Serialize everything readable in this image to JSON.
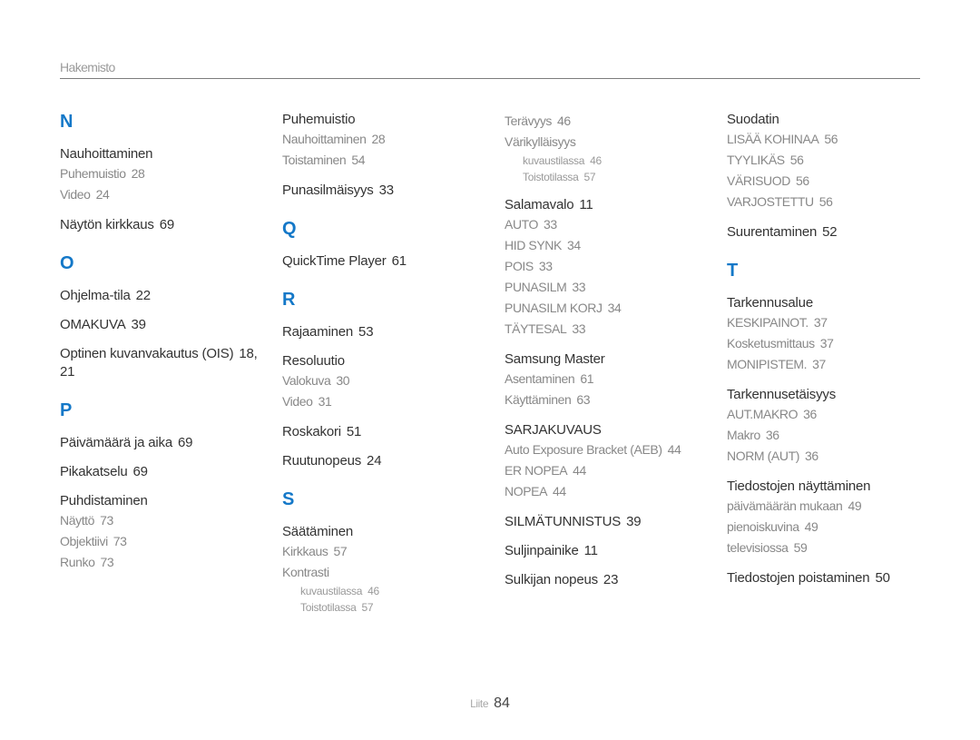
{
  "header": {
    "title": "Hakemisto"
  },
  "footer": {
    "label": "Liite",
    "page": "84"
  },
  "columns": [
    {
      "blocks": [
        {
          "letter": "N"
        },
        {
          "term": "Nauhoittaminen",
          "page": "",
          "subs": [
            {
              "term": "Puhemuistio",
              "page": "28"
            },
            {
              "term": "Video",
              "page": "24"
            }
          ]
        },
        {
          "term": "Näytön kirkkaus",
          "page": "69"
        },
        {
          "letter": "O"
        },
        {
          "term": "Ohjelma-tila",
          "page": "22"
        },
        {
          "term": "OMAKUVA",
          "page": "39"
        },
        {
          "term": "Optinen kuvanvakautus (OIS)",
          "page": "18, 21"
        },
        {
          "letter": "P"
        },
        {
          "term": "Päivämäärä ja aika",
          "page": "69"
        },
        {
          "term": "Pikakatselu",
          "page": "69"
        },
        {
          "term": "Puhdistaminen",
          "page": "",
          "subs": [
            {
              "term": "Näyttö",
              "page": "73"
            },
            {
              "term": "Objektiivi",
              "page": "73"
            },
            {
              "term": "Runko",
              "page": "73"
            }
          ]
        }
      ]
    },
    {
      "blocks": [
        {
          "term": "Puhemuistio",
          "page": "",
          "subs": [
            {
              "term": "Nauhoittaminen",
              "page": "28"
            },
            {
              "term": "Toistaminen",
              "page": "54"
            }
          ]
        },
        {
          "term": "Punasilmäisyys",
          "page": "33"
        },
        {
          "letter": "Q"
        },
        {
          "term": "QuickTime Player",
          "page": "61"
        },
        {
          "letter": "R"
        },
        {
          "term": "Rajaaminen",
          "page": "53"
        },
        {
          "term": "Resoluutio",
          "page": "",
          "subs": [
            {
              "term": "Valokuva",
              "page": "30"
            },
            {
              "term": "Video",
              "page": "31"
            }
          ]
        },
        {
          "term": "Roskakori",
          "page": "51"
        },
        {
          "term": "Ruutunopeus",
          "page": "24"
        },
        {
          "letter": "S"
        },
        {
          "term": "Säätäminen",
          "page": "",
          "subs": [
            {
              "term": "Kirkkaus",
              "page": "57"
            },
            {
              "term": "Kontrasti",
              "page": "",
              "subsubs": [
                {
                  "term": "kuvaustilassa",
                  "page": "46"
                },
                {
                  "term": "Toistotilassa",
                  "page": "57"
                }
              ]
            }
          ]
        }
      ]
    },
    {
      "blocks": [
        {
          "continuation": true,
          "subs": [
            {
              "term": "Terävyys",
              "page": "46"
            },
            {
              "term": "Värikylläisyys",
              "page": "",
              "subsubs": [
                {
                  "term": "kuvaustilassa",
                  "page": "46"
                },
                {
                  "term": "Toistotilassa",
                  "page": "57"
                }
              ]
            }
          ]
        },
        {
          "term": "Salamavalo",
          "page": "11",
          "subs": [
            {
              "term": "AUTO",
              "page": "33"
            },
            {
              "term": "HID SYNK",
              "page": "34"
            },
            {
              "term": "POIS",
              "page": "33"
            },
            {
              "term": "PUNASILM",
              "page": "33"
            },
            {
              "term": "PUNASILM KORJ",
              "page": "34"
            },
            {
              "term": "TÄYTESAL",
              "page": "33"
            }
          ]
        },
        {
          "term": "Samsung Master",
          "page": "",
          "subs": [
            {
              "term": "Asentaminen",
              "page": "61"
            },
            {
              "term": "Käyttäminen",
              "page": "63"
            }
          ]
        },
        {
          "term": "SARJAKUVAUS",
          "page": "",
          "subs": [
            {
              "term": "Auto Exposure Bracket (AEB)",
              "page": "44"
            },
            {
              "term": "ER NOPEA",
              "page": "44"
            },
            {
              "term": "NOPEA",
              "page": "44"
            }
          ]
        },
        {
          "term": "SILMÄTUNNISTUS",
          "page": "39"
        },
        {
          "term": "Suljinpainike",
          "page": "11"
        },
        {
          "term": "Sulkijan nopeus",
          "page": "23"
        }
      ]
    },
    {
      "blocks": [
        {
          "term": "Suodatin",
          "page": "",
          "subs": [
            {
              "term": "LISÄÄ KOHINAA",
              "page": "56"
            },
            {
              "term": "TYYLIKÄS",
              "page": "56"
            },
            {
              "term": "VÄRISUOD",
              "page": "56"
            },
            {
              "term": "VARJOSTETTU",
              "page": "56"
            }
          ]
        },
        {
          "term": "Suurentaminen",
          "page": "52"
        },
        {
          "letter": "T"
        },
        {
          "term": "Tarkennusalue",
          "page": "",
          "subs": [
            {
              "term": "KESKIPAINOT.",
              "page": "37"
            },
            {
              "term": "Kosketusmittaus",
              "page": "37"
            },
            {
              "term": "MONIPISTEM.",
              "page": "37"
            }
          ]
        },
        {
          "term": "Tarkennusetäisyys",
          "page": "",
          "subs": [
            {
              "term": "AUT.MAKRO",
              "page": "36"
            },
            {
              "term": "Makro",
              "page": "36"
            },
            {
              "term": "NORM (AUT)",
              "page": "36"
            }
          ]
        },
        {
          "term": "Tiedostojen näyttäminen",
          "page": "",
          "subs": [
            {
              "term": "päivämäärän mukaan",
              "page": "49"
            },
            {
              "term": "pienoiskuvina",
              "page": "49"
            },
            {
              "term": "televisiossa",
              "page": "59"
            }
          ]
        },
        {
          "term": "Tiedostojen poistaminen",
          "page": "50"
        }
      ]
    }
  ],
  "colors": {
    "accent": "#1478c8",
    "term": "#333333",
    "sub": "#888888",
    "rule": "#7c7c7c"
  }
}
